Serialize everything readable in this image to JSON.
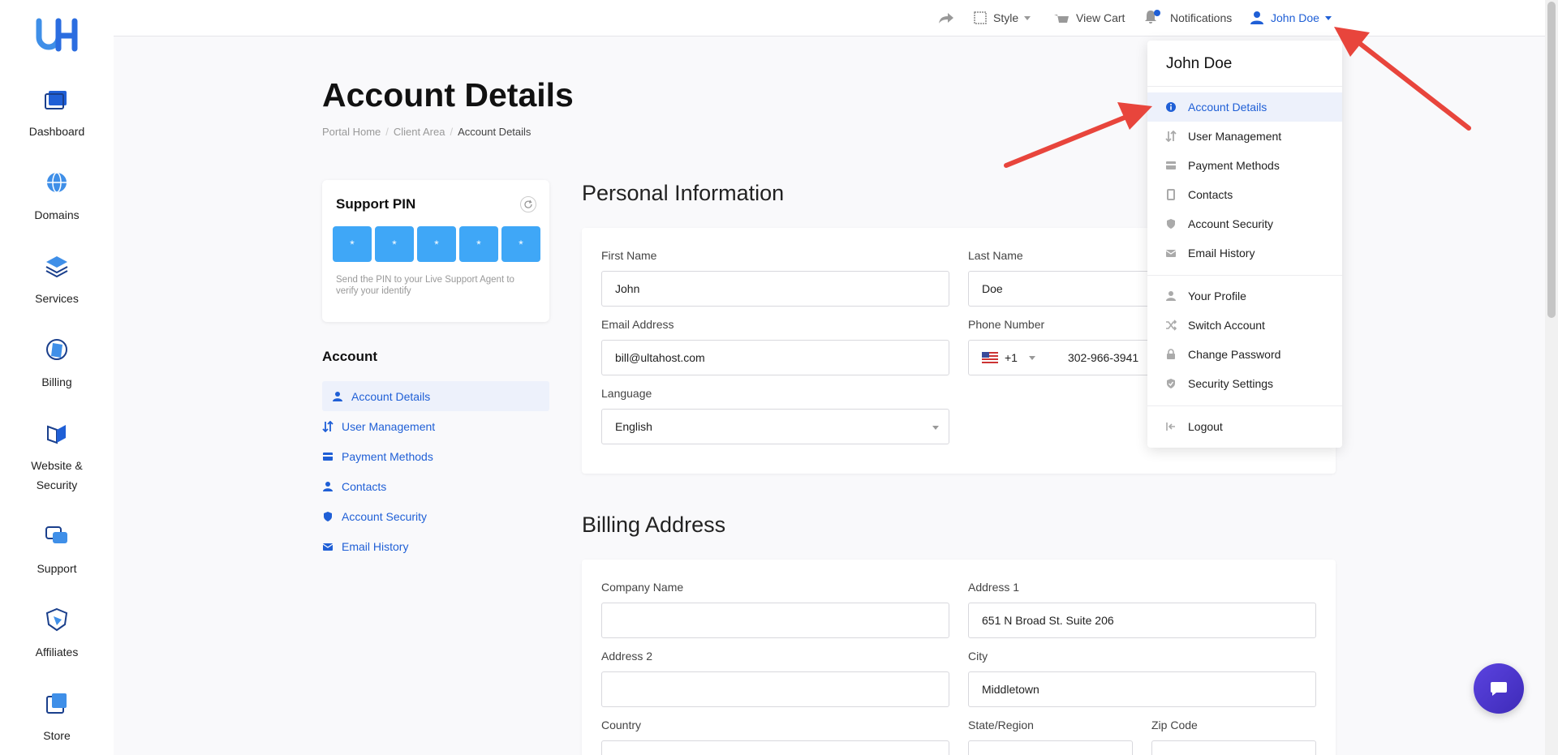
{
  "sidebar": {
    "items": [
      {
        "label": "Dashboard",
        "icon": "dashboard-icon"
      },
      {
        "label": "Domains",
        "icon": "globe-icon"
      },
      {
        "label": "Services",
        "icon": "layers-icon"
      },
      {
        "label": "Billing",
        "icon": "billing-icon"
      },
      {
        "label": "Website &",
        "label2": "Security",
        "icon": "shield-book-icon"
      },
      {
        "label": "Support",
        "icon": "chat-icon"
      },
      {
        "label": "Affiliates",
        "icon": "affiliate-shield-icon"
      },
      {
        "label": "Store",
        "icon": "store-icon"
      }
    ]
  },
  "topbar": {
    "style": "Style",
    "view_cart": "View Cart",
    "notifications": "Notifications",
    "user": "John Doe"
  },
  "page": {
    "title": "Account Details",
    "breadcrumb": [
      "Portal Home",
      "Client Area",
      "Account Details"
    ]
  },
  "support_pin": {
    "title": "Support PIN",
    "digits": [
      "*",
      "*",
      "*",
      "*",
      "*"
    ],
    "help": "Send the PIN to your Live Support Agent to verify your identify"
  },
  "account_nav": {
    "title": "Account",
    "items": [
      "Account Details",
      "User Management",
      "Payment Methods",
      "Contacts",
      "Account Security",
      "Email History"
    ]
  },
  "personal": {
    "title": "Personal Information",
    "first_name_label": "First Name",
    "first_name": "John",
    "last_name_label": "Last Name",
    "last_name": "Doe",
    "email_label": "Email Address",
    "email": "bill@ultahost.com",
    "phone_label": "Phone Number",
    "phone_code": "+1",
    "phone": "302-966-3941",
    "language_label": "Language",
    "language": "English"
  },
  "billing": {
    "title": "Billing Address",
    "company_label": "Company Name",
    "company": "",
    "address1_label": "Address 1",
    "address1": "651 N Broad St. Suite 206",
    "address2_label": "Address 2",
    "address2": "",
    "city_label": "City",
    "city": "Middletown",
    "country_label": "Country",
    "state_label": "State/Region",
    "zip_label": "Zip Code"
  },
  "dropdown": {
    "name": "John Doe",
    "group1": [
      "Account Details",
      "User Management",
      "Payment Methods",
      "Contacts",
      "Account Security",
      "Email History"
    ],
    "group2": [
      "Your Profile",
      "Switch Account",
      "Change Password",
      "Security Settings"
    ],
    "logout": "Logout"
  },
  "colors": {
    "accent": "#1f5fd6",
    "pin": "#3fa7f7",
    "chat": "#4b35cc",
    "arrow": "#e8453c"
  }
}
